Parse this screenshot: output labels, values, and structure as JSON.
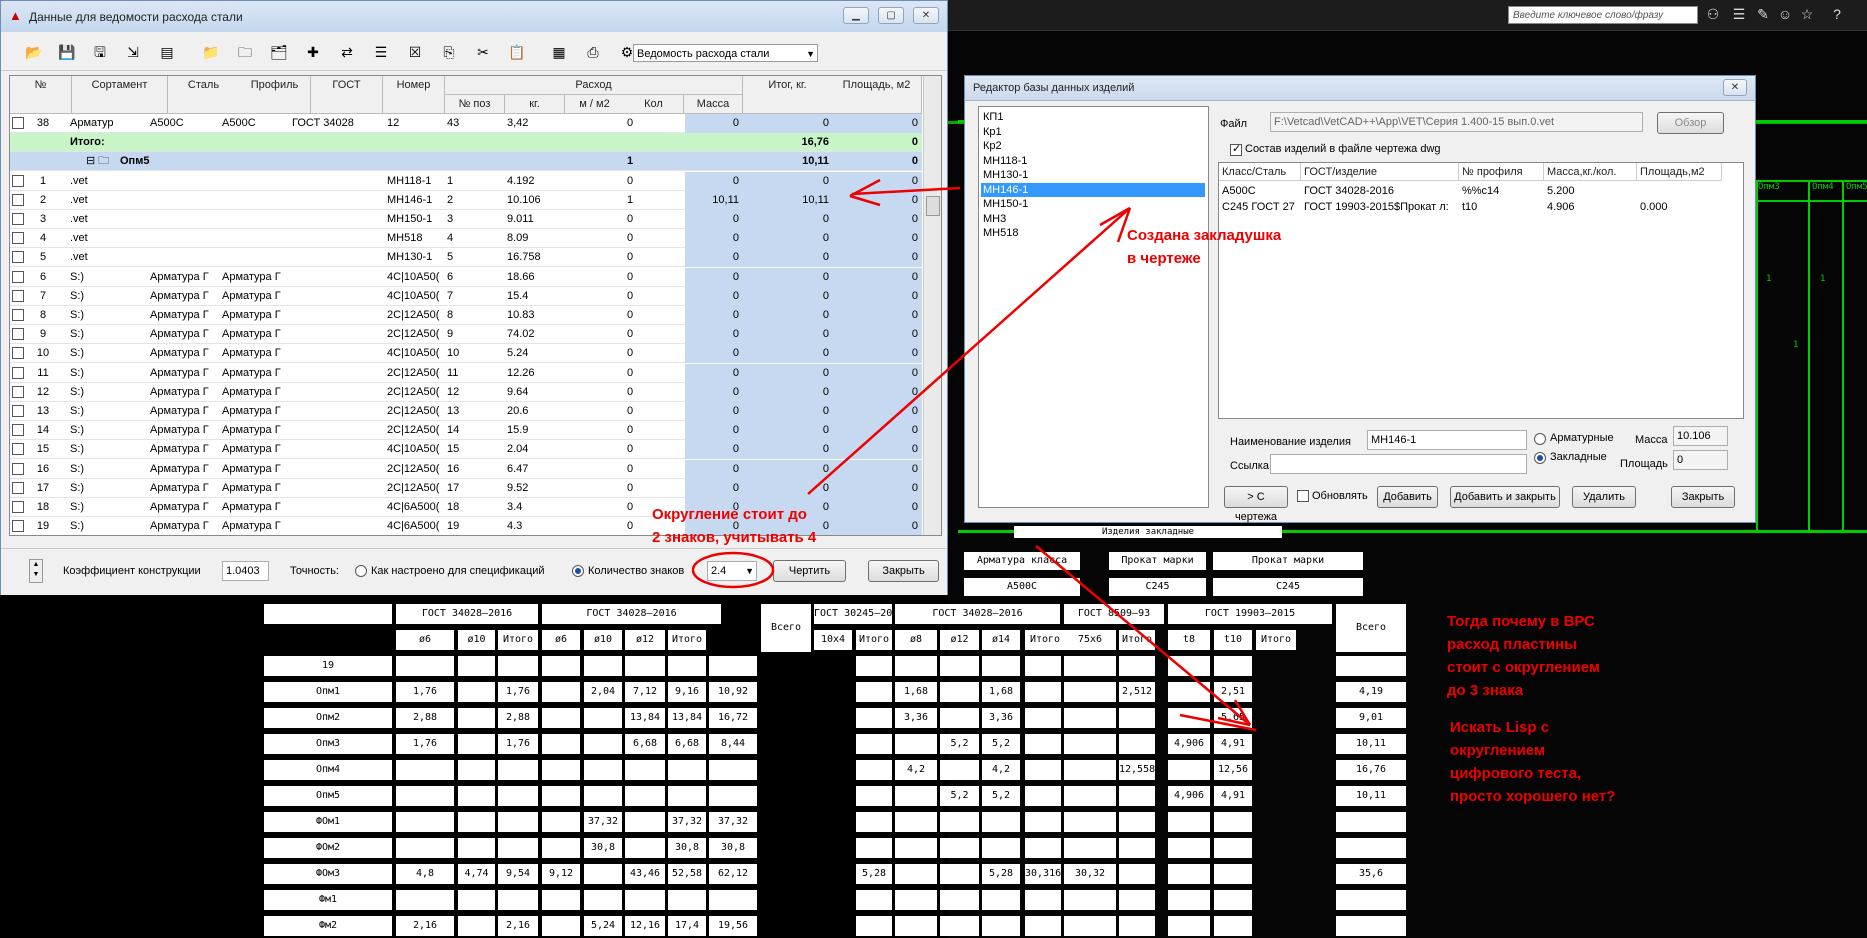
{
  "cad": {
    "search_placeholder": "Введите ключевое слово/фразу",
    "toolbar_icons": [
      "binoculars-icon",
      "wrench-icon",
      "user-icon",
      "star-icon",
      "help-icon"
    ],
    "grid_labels": [
      "Опм3",
      "Опм4",
      "Опм5",
      "1",
      "1",
      "1"
    ],
    "table": {
      "group_title": "Изделия закладные",
      "head_groups": [
        "Арматура класса",
        "Прокат марки",
        "Прокат марки"
      ],
      "head_steels": [
        "A500С",
        "С245",
        "С245"
      ],
      "gost_row": [
        "ГОСТ 34028–2016",
        "ГОСТ 34028–2016",
        "Всего",
        "ГОСТ 30245–2003",
        "ГОСТ 34028–2016",
        "ГОСТ 8509–93",
        "ГОСТ 19903–2015",
        "Всего"
      ],
      "col_heads": [
        "ø6",
        "ø10",
        "Итого",
        "ø6",
        "ø10",
        "ø12",
        "Итого",
        "10х4",
        "Итого",
        "ø8",
        "ø12",
        "ø14",
        "Итого",
        "75х6",
        "Итого",
        "t8",
        "t10",
        "Итого"
      ],
      "rows": [
        {
          "name": "19",
          "vals": [
            "",
            "",
            "",
            "",
            "",
            "",
            "",
            "",
            "",
            "",
            "",
            "",
            "",
            "",
            "",
            "",
            "",
            "",
            "",
            ""
          ]
        },
        {
          "name": "Опм1",
          "vals": [
            "1,76",
            "",
            "1,76",
            "",
            "2,04",
            "7,12",
            "9,16",
            "10,92",
            "",
            "",
            "1,68",
            "",
            "1,68",
            "",
            "",
            "2,512",
            "",
            "2,51",
            "4,19"
          ]
        },
        {
          "name": "Опм2",
          "vals": [
            "2,88",
            "",
            "2,88",
            "",
            "",
            "13,84",
            "13,84",
            "16,72",
            "",
            "",
            "3,36",
            "",
            "3,36",
            "",
            "",
            "",
            "",
            "5,65",
            "9,01"
          ]
        },
        {
          "name": "Опм3",
          "vals": [
            "1,76",
            "",
            "1,76",
            "",
            "",
            "6,68",
            "6,68",
            "8,44",
            "",
            "",
            "",
            "5,2",
            "5,2",
            "",
            "",
            "",
            "4,906",
            "4,91",
            "10,11"
          ]
        },
        {
          "name": "Опм4",
          "vals": [
            "",
            "",
            "",
            "",
            "",
            "",
            "",
            "",
            "",
            "",
            "4,2",
            "",
            "4,2",
            "",
            "",
            "12,558",
            "",
            "12,56",
            "16,76"
          ]
        },
        {
          "name": "Опм5",
          "vals": [
            "",
            "",
            "",
            "",
            "",
            "",
            "",
            "",
            "",
            "",
            "",
            "5,2",
            "5,2",
            "",
            "",
            "",
            "4,906",
            "4,91",
            "10,11"
          ]
        },
        {
          "name": "ФОм1",
          "vals": [
            "",
            "",
            "",
            "",
            "37,32",
            "",
            "37,32",
            "37,32",
            "",
            "",
            "",
            "",
            "",
            "",
            "",
            "",
            "",
            "",
            ""
          ]
        },
        {
          "name": "ФОм2",
          "vals": [
            "",
            "",
            "",
            "",
            "30,8",
            "",
            "30,8",
            "30,8",
            "",
            "",
            "",
            "",
            "",
            "",
            "",
            "",
            "",
            "",
            ""
          ]
        },
        {
          "name": "ФОм3",
          "vals": [
            "4,8",
            "4,74",
            "9,54",
            "9,12",
            "",
            "43,46",
            "52,58",
            "62,12",
            "",
            "5,28",
            "",
            "",
            "5,28",
            "30,316",
            "30,32",
            "",
            "",
            "",
            "35,6"
          ]
        },
        {
          "name": "Фм1",
          "vals": [
            "",
            "",
            "",
            "",
            "",
            "",
            "",
            "",
            "",
            "",
            "",
            "",
            "",
            "",
            "",
            "",
            "",
            "",
            ""
          ]
        },
        {
          "name": "Фм2",
          "vals": [
            "2,16",
            "",
            "2,16",
            "",
            "5,24",
            "12,16",
            "17,4",
            "19,56",
            "",
            "",
            "",
            "",
            "",
            "",
            "",
            "",
            "",
            "",
            ""
          ]
        }
      ]
    }
  },
  "main": {
    "title": "Данные для ведомости расхода стали",
    "report_combo": "Ведомость расхода стали",
    "headers": {
      "num": "№",
      "sortament": "Сортамент",
      "steel": "Сталь",
      "profile": "Профиль",
      "gost": "ГОСТ",
      "nomer": "Номер",
      "rashod": "Расход",
      "npos": "№ поз",
      "kg": "кг.",
      "m_m2": "м / м2",
      "kol": "Кол",
      "massa": "Масса",
      "itog": "Итог, кг.",
      "area": "Площадь, м2"
    },
    "rows": [
      {
        "n": "38",
        "sort": "Арматур",
        "steel": "A500C",
        "prof": "A500C",
        "gost": "ГОСТ 34028",
        "nomer": "12",
        "pos": "43",
        "kg": "3,42",
        "mm": "",
        "kol": "0",
        "mass": "0",
        "itog": "0",
        "area": "0",
        "kind": "plain"
      },
      {
        "n": "",
        "sort": "Итого:",
        "steel": "",
        "prof": "",
        "gost": "",
        "nomer": "",
        "pos": "",
        "kg": "",
        "mm": "",
        "kol": "",
        "mass": "",
        "itog": "16,76",
        "area": "0",
        "kind": "total"
      },
      {
        "n": "",
        "sort": "Опм5",
        "steel": "",
        "prof": "",
        "gost": "",
        "nomer": "",
        "pos": "",
        "kg": "",
        "mm": "",
        "kol": "1",
        "mass": "",
        "itog": "10,11",
        "area": "0",
        "kind": "group"
      },
      {
        "n": "1",
        "sort": ".vet",
        "steel": "",
        "prof": "",
        "gost": "",
        "nomer": "МН118-1",
        "pos": "1",
        "kg": "4.192",
        "mm": "",
        "kol": "0",
        "mass": "0",
        "itog": "0",
        "area": "0",
        "kind": "plain"
      },
      {
        "n": "2",
        "sort": ".vet",
        "steel": "",
        "prof": "",
        "gost": "",
        "nomer": "МН146-1",
        "pos": "2",
        "kg": "10.106",
        "mm": "",
        "kol": "1",
        "mass": "10,11",
        "itog": "10,11",
        "area": "0",
        "kind": "plain"
      },
      {
        "n": "3",
        "sort": ".vet",
        "steel": "",
        "prof": "",
        "gost": "",
        "nomer": "МН150-1",
        "pos": "3",
        "kg": "9.011",
        "mm": "",
        "kol": "0",
        "mass": "0",
        "itog": "0",
        "area": "0",
        "kind": "plain"
      },
      {
        "n": "4",
        "sort": ".vet",
        "steel": "",
        "prof": "",
        "gost": "",
        "nomer": "МН518",
        "pos": "4",
        "kg": "8.09",
        "mm": "",
        "kol": "0",
        "mass": "0",
        "itog": "0",
        "area": "0",
        "kind": "plain"
      },
      {
        "n": "5",
        "sort": ".vet",
        "steel": "",
        "prof": "",
        "gost": "",
        "nomer": "МН130-1",
        "pos": "5",
        "kg": "16.758",
        "mm": "",
        "kol": "0",
        "mass": "0",
        "itog": "0",
        "area": "0",
        "kind": "plain"
      },
      {
        "n": "6",
        "sort": "S:)",
        "steel": "Арматура Г",
        "prof": "Арматура Г",
        "gost": "",
        "nomer": "4С|10А50(",
        "pos": "6",
        "kg": "18.66",
        "mm": "",
        "kol": "0",
        "mass": "0",
        "itog": "0",
        "area": "0",
        "kind": "plain"
      },
      {
        "n": "7",
        "sort": "S:)",
        "steel": "Арматура Г",
        "prof": "Арматура Г",
        "gost": "",
        "nomer": "4С|10А50(",
        "pos": "7",
        "kg": "15.4",
        "mm": "",
        "kol": "0",
        "mass": "0",
        "itog": "0",
        "area": "0",
        "kind": "plain"
      },
      {
        "n": "8",
        "sort": "S:)",
        "steel": "Арматура Г",
        "prof": "Арматура Г",
        "gost": "",
        "nomer": "2С|12А50(",
        "pos": "8",
        "kg": "10.83",
        "mm": "",
        "kol": "0",
        "mass": "0",
        "itog": "0",
        "area": "0",
        "kind": "plain"
      },
      {
        "n": "9",
        "sort": "S:)",
        "steel": "Арматура Г",
        "prof": "Арматура Г",
        "gost": "",
        "nomer": "2С|12А50(",
        "pos": "9",
        "kg": "74.02",
        "mm": "",
        "kol": "0",
        "mass": "0",
        "itog": "0",
        "area": "0",
        "kind": "plain"
      },
      {
        "n": "10",
        "sort": "S:)",
        "steel": "Арматура Г",
        "prof": "Арматура Г",
        "gost": "",
        "nomer": "4С|10А50(",
        "pos": "10",
        "kg": "5.24",
        "mm": "",
        "kol": "0",
        "mass": "0",
        "itog": "0",
        "area": "0",
        "kind": "plain"
      },
      {
        "n": "11",
        "sort": "S:)",
        "steel": "Арматура Г",
        "prof": "Арматура Г",
        "gost": "",
        "nomer": "2С|12А50(",
        "pos": "11",
        "kg": "12.26",
        "mm": "",
        "kol": "0",
        "mass": "0",
        "itog": "0",
        "area": "0",
        "kind": "plain"
      },
      {
        "n": "12",
        "sort": "S:)",
        "steel": "Арматура Г",
        "prof": "Арматура Г",
        "gost": "",
        "nomer": "2С|12А50(",
        "pos": "12",
        "kg": "9.64",
        "mm": "",
        "kol": "0",
        "mass": "0",
        "itog": "0",
        "area": "0",
        "kind": "plain"
      },
      {
        "n": "13",
        "sort": "S:)",
        "steel": "Арматура Г",
        "prof": "Арматура Г",
        "gost": "",
        "nomer": "2С|12А50(",
        "pos": "13",
        "kg": "20.6",
        "mm": "",
        "kol": "0",
        "mass": "0",
        "itog": "0",
        "area": "0",
        "kind": "plain"
      },
      {
        "n": "14",
        "sort": "S:)",
        "steel": "Арматура Г",
        "prof": "Арматура Г",
        "gost": "",
        "nomer": "2С|12А50(",
        "pos": "14",
        "kg": "15.9",
        "mm": "",
        "kol": "0",
        "mass": "0",
        "itog": "0",
        "area": "0",
        "kind": "plain"
      },
      {
        "n": "15",
        "sort": "S:)",
        "steel": "Арматура Г",
        "prof": "Арматура Г",
        "gost": "",
        "nomer": "4С|10А50(",
        "pos": "15",
        "kg": "2.04",
        "mm": "",
        "kol": "0",
        "mass": "0",
        "itog": "0",
        "area": "0",
        "kind": "plain"
      },
      {
        "n": "16",
        "sort": "S:)",
        "steel": "Арматура Г",
        "prof": "Арматура Г",
        "gost": "",
        "nomer": "2С|12А50(",
        "pos": "16",
        "kg": "6.47",
        "mm": "",
        "kol": "0",
        "mass": "0",
        "itog": "0",
        "area": "0",
        "kind": "plain"
      },
      {
        "n": "17",
        "sort": "S:)",
        "steel": "Арматура Г",
        "prof": "Арматура Г",
        "gost": "",
        "nomer": "2С|12А50(",
        "pos": "17",
        "kg": "9.52",
        "mm": "",
        "kol": "0",
        "mass": "0",
        "itog": "0",
        "area": "0",
        "kind": "plain"
      },
      {
        "n": "18",
        "sort": "S:)",
        "steel": "Арматура Г",
        "prof": "Арматура Г",
        "gost": "",
        "nomer": "4С|6А500(",
        "pos": "18",
        "kg": "3.4",
        "mm": "",
        "kol": "0",
        "mass": "0",
        "itog": "0",
        "area": "0",
        "kind": "plain"
      },
      {
        "n": "19",
        "sort": "S:)",
        "steel": "Арматура Г",
        "prof": "Арматура Г",
        "gost": "",
        "nomer": "4С|6А500(",
        "pos": "19",
        "kg": "4.3",
        "mm": "",
        "kol": "0",
        "mass": "0",
        "itog": "0",
        "area": "0",
        "kind": "plain"
      }
    ],
    "bottom": {
      "coef_label": "Коэффициент конструкции",
      "coef_value": "1.0403",
      "precision_label": "Точность:",
      "radio_spec": "Как настроено для спецификаций",
      "radio_digits": "Количество знаков",
      "digits_value": "2.4",
      "draw_button": "Чертить",
      "close_button": "Закрыть"
    }
  },
  "editor": {
    "title": "Редактор базы данных изделий",
    "list": [
      "КП1",
      "Кр1",
      "Кр2",
      "МН118-1",
      "МН130-1",
      "МН146-1",
      "МН150-1",
      "МН3",
      "МН518"
    ],
    "selected_index": 5,
    "file_label": "Файл",
    "file_value": "F:\\Vetcad\\VetCAD++\\App\\VET\\Серия 1.400-15 вып.0.vet",
    "browse": "Обзор",
    "checkbox_label": "Состав изделий в файле чертежа dwg",
    "grid_headers": [
      "Класс/Сталь",
      "ГОСТ/изделие",
      "№ профиля",
      "Масса,кг./кол.",
      "Площадь,м2"
    ],
    "grid_rows": [
      [
        "A500C",
        "ГОСТ 34028-2016",
        "%%с14",
        "5.200",
        ""
      ],
      [
        "С245 ГОСТ 27",
        "ГОСТ 19903-2015$Прокат л:",
        "t10",
        "4.906",
        "0.000"
      ]
    ],
    "name_label": "Наименование изделия",
    "name_value": "МН146-1",
    "link_label": "Ссылка",
    "radio_arm": "Арматурные",
    "radio_zakl": "Закладные",
    "mass_label": "Масса",
    "mass_value": "10.106",
    "area_label": "Площадь",
    "area_value": "0",
    "buttons": {
      "from_drawing": "> С чертежа",
      "update": "Обновлять",
      "add": "Добавить",
      "add_close": "Добавить и закрыть",
      "delete": "Удалить",
      "close": "Закрыть"
    }
  },
  "annotations": {
    "bookmark": [
      "Создана закладушка",
      "в чертеже"
    ],
    "rounding": [
      "Округление стоит до",
      "2 знаков, учитывать 4"
    ],
    "question": [
      "Тогда почему в ВРС",
      "расход пластины",
      "стоит с округлением",
      "до 3 знака"
    ],
    "lisp": [
      "Искать Lisp с",
      "округлением",
      "цифрового теста,",
      "просто хорошего нет?"
    ],
    "color": "#e00000"
  }
}
